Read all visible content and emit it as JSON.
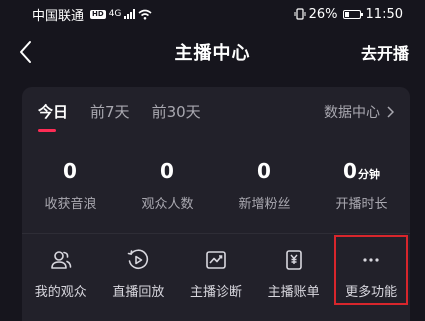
{
  "status_bar": {
    "carrier": "中国联通",
    "hd": "HD",
    "network": "4G",
    "battery_level": 0.26,
    "battery_text": "26%",
    "time": "11:50"
  },
  "nav": {
    "title": "主播中心",
    "action": "去开播",
    "back_icon": "chevron-left-icon"
  },
  "tabs": [
    {
      "label": "今日",
      "active": true
    },
    {
      "label": "前7天",
      "active": false
    },
    {
      "label": "前30天",
      "active": false
    }
  ],
  "data_center": {
    "label": "数据中心"
  },
  "stats": [
    {
      "value": "0",
      "unit": "",
      "label": "收获音浪"
    },
    {
      "value": "0",
      "unit": "",
      "label": "观众人数"
    },
    {
      "value": "0",
      "unit": "",
      "label": "新增粉丝"
    },
    {
      "value": "0",
      "unit": "分钟",
      "label": "开播时长"
    }
  ],
  "tools": [
    {
      "label": "我的观众",
      "icon": "audience-icon"
    },
    {
      "label": "直播回放",
      "icon": "replay-icon"
    },
    {
      "label": "主播诊断",
      "icon": "diagnosis-icon"
    },
    {
      "label": "主播账单",
      "icon": "bill-icon"
    },
    {
      "label": "更多功能",
      "icon": "more-icon"
    }
  ],
  "colors": {
    "background": "#16151d",
    "card": "#22212a",
    "accent": "#fe2c55",
    "highlight": "#d8262c"
  }
}
